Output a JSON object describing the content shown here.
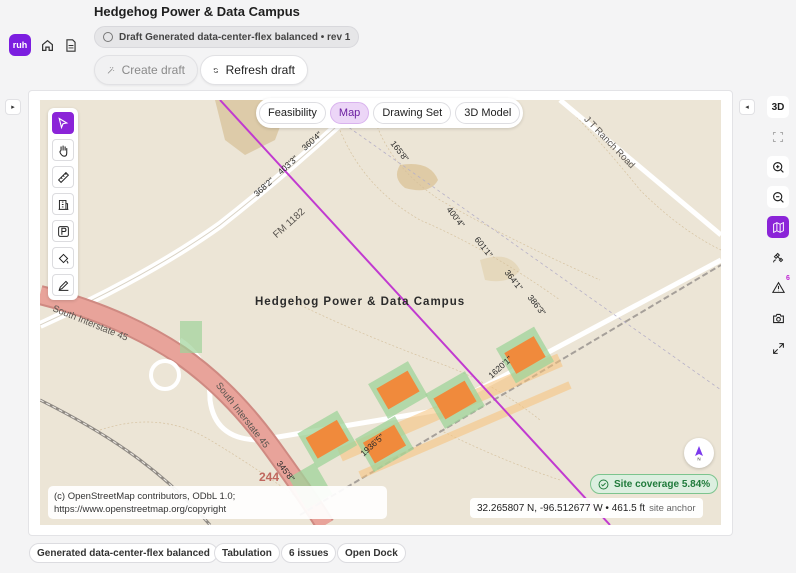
{
  "app": {
    "logo_text": "ruh"
  },
  "header": {
    "title": "Hedgehog Power & Data Campus",
    "draft_status": "Draft Generated data-center-flex balanced • rev 1",
    "create_draft_label": "Create draft",
    "refresh_draft_label": "Refresh draft"
  },
  "view_tabs": [
    {
      "label": "Feasibility",
      "active": false
    },
    {
      "label": "Map",
      "active": true
    },
    {
      "label": "Drawing Set",
      "active": false
    },
    {
      "label": "3D Model",
      "active": false
    }
  ],
  "toolbar": {
    "tools": [
      "select",
      "pan",
      "measure",
      "building",
      "parking",
      "fill",
      "draw"
    ],
    "active_tool": "select"
  },
  "right_toolbar": {
    "label_3d": "3D",
    "active_tool": "map-layers",
    "alerts_count": "6"
  },
  "map": {
    "site_label": "Hedgehog Power & Data Campus",
    "road_labels": {
      "fm": "FM 1182",
      "ranch": "J T Ranch Road",
      "interstate_upper": "South Interstate 45",
      "interstate_lower": "South Interstate 45",
      "interstate_shield": "244"
    },
    "dimension_labels": [
      "368'2\"",
      "403'3\"",
      "360'4\"",
      "165'8\"",
      "400'4\"",
      "601'1\"",
      "364'1\"",
      "386'3\"",
      "1620'1\"",
      "1936'5\"",
      "345'8\""
    ],
    "attribution_line1": "(c) OpenStreetMap contributors, ODbL 1.0;",
    "attribution_line2": "https://www.openstreetmap.org/copyright",
    "coordinates": "32.265807 N, -96.512677 W • 461.5 ft",
    "coordinates_suffix": "site anchor",
    "site_coverage": "Site coverage 5.84%",
    "compass_label": "N"
  },
  "bottom_bar": {
    "scenario": "Generated data-center-flex balanced",
    "tabulation": "Tabulation",
    "issues": "6 issues",
    "dock": "Open Dock"
  },
  "colors": {
    "accent": "#8b24d8",
    "map_background": "#ece5d6",
    "interstate": "#e8a39a",
    "building": "#f08a3c",
    "green_pad": "#9fd39a",
    "coverage_green": "#1f7a3a"
  }
}
